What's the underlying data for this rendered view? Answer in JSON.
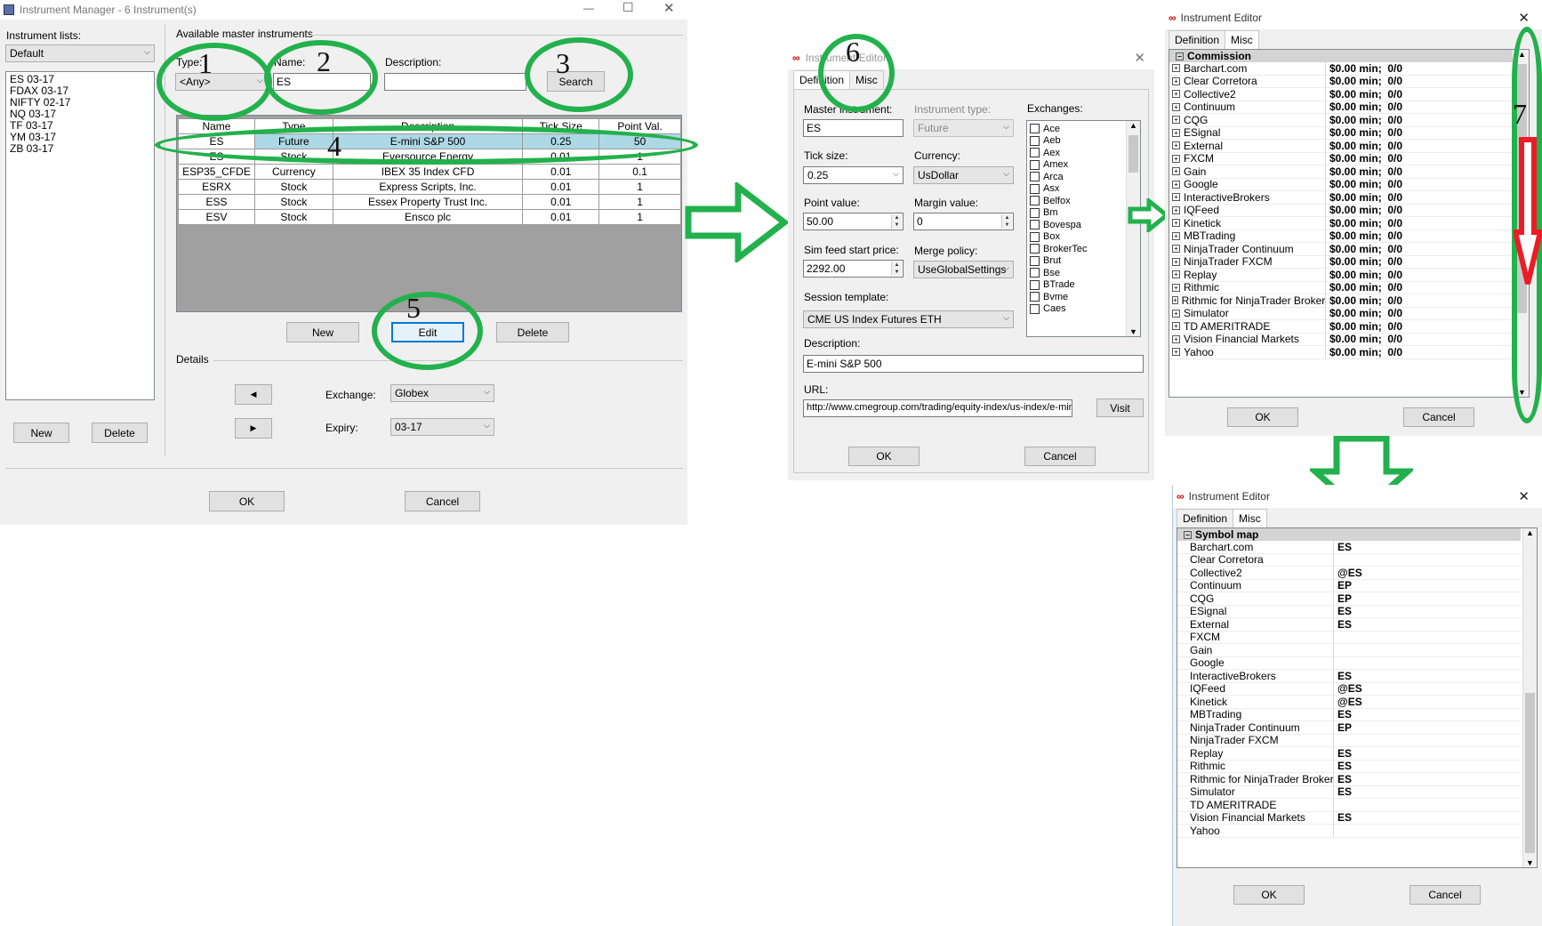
{
  "instrument_manager": {
    "title": "Instrument Manager - 6 Instrument(s)",
    "lists_label": "Instrument lists:",
    "list_selected": "Default",
    "list_items": [
      "ES 03-17",
      "FDAX 03-17",
      "NIFTY 02-17",
      "NQ 03-17",
      "TF 03-17",
      "YM 03-17",
      "ZB 03-17"
    ],
    "new_label": "New",
    "delete_label": "Delete",
    "available_label": "Available master instruments",
    "type_label": "Type:",
    "type_value": "<Any>",
    "name_label": "Name:",
    "name_value": "ES",
    "description_label": "Description:",
    "description_value": "",
    "search_label": "Search",
    "columns": [
      "Name",
      "Type",
      "Description",
      "Tick Size",
      "Point Val."
    ],
    "rows": [
      {
        "name": "ES",
        "type": "Future",
        "description": "E-mini S&P 500",
        "tick": "0.25",
        "point": "50",
        "selected": true
      },
      {
        "name": "ES",
        "type": "Stock",
        "description": "Eversource Energy",
        "tick": "0.01",
        "point": "1",
        "selected": false
      },
      {
        "name": "ESP35_CFDE",
        "type": "Currency",
        "description": "IBEX 35 Index CFD",
        "tick": "0.01",
        "point": "0.1",
        "selected": false
      },
      {
        "name": "ESRX",
        "type": "Stock",
        "description": "Express Scripts, Inc.",
        "tick": "0.01",
        "point": "1",
        "selected": false
      },
      {
        "name": "ESS",
        "type": "Stock",
        "description": "Essex Property Trust Inc.",
        "tick": "0.01",
        "point": "1",
        "selected": false
      },
      {
        "name": "ESV",
        "type": "Stock",
        "description": "Ensco plc",
        "tick": "0.01",
        "point": "1",
        "selected": false
      }
    ],
    "grid_new": "New",
    "grid_edit": "Edit",
    "grid_delete": "Delete",
    "details_label": "Details",
    "exchange_label": "Exchange:",
    "exchange_value": "Globex",
    "expiry_label": "Expiry:",
    "expiry_value": "03-17",
    "ok_label": "OK",
    "cancel_label": "Cancel"
  },
  "instrument_editor_1": {
    "title": "Instrument Editor",
    "tab_definition": "Definition",
    "tab_misc": "Misc",
    "master_label": "Master instrument:",
    "master_value": "ES",
    "type_label": "Instrument type:",
    "type_value": "Future",
    "exchanges_label": "Exchanges:",
    "exchanges": [
      "Ace",
      "Aeb",
      "Aex",
      "Amex",
      "Arca",
      "Asx",
      "Belfox",
      "Bm",
      "Bovespa",
      "Box",
      "BrokerTec",
      "Brut",
      "Bse",
      "BTrade",
      "Bvme",
      "Caes"
    ],
    "tick_label": "Tick size:",
    "tick_value": "0.25",
    "currency_label": "Currency:",
    "currency_value": "UsDollar",
    "point_label": "Point value:",
    "point_value": "50.00",
    "margin_label": "Margin value:",
    "margin_value": "0",
    "sim_label": "Sim feed start price:",
    "sim_value": "2292.00",
    "merge_label": "Merge policy:",
    "merge_value": "UseGlobalSettings",
    "session_label": "Session template:",
    "session_value": "CME US Index Futures ETH",
    "desc_label": "Description:",
    "desc_value": "E-mini S&P 500",
    "url_label": "URL:",
    "url_value": "http://www.cmegroup.com/trading/equity-index/us-index/e-mini-s",
    "visit_label": "Visit",
    "ok_label": "OK",
    "cancel_label": "Cancel"
  },
  "instrument_editor_commission": {
    "title": "Instrument Editor",
    "tab_definition": "Definition",
    "tab_misc": "Misc",
    "section": "Commission",
    "rows": [
      {
        "name": "Barchart.com",
        "value": "$0.00 min;  0/0"
      },
      {
        "name": "Clear Corretora",
        "value": "$0.00 min;  0/0"
      },
      {
        "name": "Collective2",
        "value": "$0.00 min;  0/0"
      },
      {
        "name": "Continuum",
        "value": "$0.00 min;  0/0"
      },
      {
        "name": "CQG",
        "value": "$0.00 min;  0/0"
      },
      {
        "name": "ESignal",
        "value": "$0.00 min;  0/0"
      },
      {
        "name": "External",
        "value": "$0.00 min;  0/0"
      },
      {
        "name": "FXCM",
        "value": "$0.00 min;  0/0"
      },
      {
        "name": "Gain",
        "value": "$0.00 min;  0/0"
      },
      {
        "name": "Google",
        "value": "$0.00 min;  0/0"
      },
      {
        "name": "InteractiveBrokers",
        "value": "$0.00 min;  0/0"
      },
      {
        "name": "IQFeed",
        "value": "$0.00 min;  0/0"
      },
      {
        "name": "Kinetick",
        "value": "$0.00 min;  0/0"
      },
      {
        "name": "MBTrading",
        "value": "$0.00 min;  0/0"
      },
      {
        "name": "NinjaTrader Continuum",
        "value": "$0.00 min;  0/0"
      },
      {
        "name": "NinjaTrader FXCM",
        "value": "$0.00 min;  0/0"
      },
      {
        "name": "Replay",
        "value": "$0.00 min;  0/0"
      },
      {
        "name": "Rithmic",
        "value": "$0.00 min;  0/0"
      },
      {
        "name": "Rithmic for NinjaTrader Brokerage",
        "value": "$0.00 min;  0/0"
      },
      {
        "name": "Simulator",
        "value": "$0.00 min;  0/0"
      },
      {
        "name": "TD AMERITRADE",
        "value": "$0.00 min;  0/0"
      },
      {
        "name": "Vision Financial Markets",
        "value": "$0.00 min;  0/0"
      },
      {
        "name": "Yahoo",
        "value": "$0.00 min;  0/0"
      }
    ],
    "ok_label": "OK",
    "cancel_label": "Cancel"
  },
  "instrument_editor_symbolmap": {
    "title": "Instrument Editor",
    "tab_definition": "Definition",
    "tab_misc": "Misc",
    "section": "Symbol map",
    "rows": [
      {
        "name": "Barchart.com",
        "value": "ES"
      },
      {
        "name": "Clear Corretora",
        "value": ""
      },
      {
        "name": "Collective2",
        "value": "@ES"
      },
      {
        "name": "Continuum",
        "value": "EP"
      },
      {
        "name": "CQG",
        "value": "EP"
      },
      {
        "name": "ESignal",
        "value": "ES"
      },
      {
        "name": "External",
        "value": "ES"
      },
      {
        "name": "FXCM",
        "value": ""
      },
      {
        "name": "Gain",
        "value": ""
      },
      {
        "name": "Google",
        "value": ""
      },
      {
        "name": "InteractiveBrokers",
        "value": "ES"
      },
      {
        "name": "IQFeed",
        "value": "@ES"
      },
      {
        "name": "Kinetick",
        "value": "@ES"
      },
      {
        "name": "MBTrading",
        "value": "ES"
      },
      {
        "name": "NinjaTrader Continuum",
        "value": "EP"
      },
      {
        "name": "NinjaTrader FXCM",
        "value": ""
      },
      {
        "name": "Replay",
        "value": "ES"
      },
      {
        "name": "Rithmic",
        "value": "ES"
      },
      {
        "name": "Rithmic for NinjaTrader Brokerage",
        "value": "ES"
      },
      {
        "name": "Simulator",
        "value": "ES"
      },
      {
        "name": "TD AMERITRADE",
        "value": ""
      },
      {
        "name": "Vision Financial Markets",
        "value": "ES"
      },
      {
        "name": "Yahoo",
        "value": ""
      }
    ],
    "ok_label": "OK",
    "cancel_label": "Cancel"
  },
  "step_numbers": [
    "1",
    "2",
    "3",
    "4",
    "5",
    "6",
    "7"
  ],
  "colors": {
    "highlight_green": "#22b14c",
    "arrow_red": "#ed1c24",
    "selection_blue": "#add8e6"
  }
}
